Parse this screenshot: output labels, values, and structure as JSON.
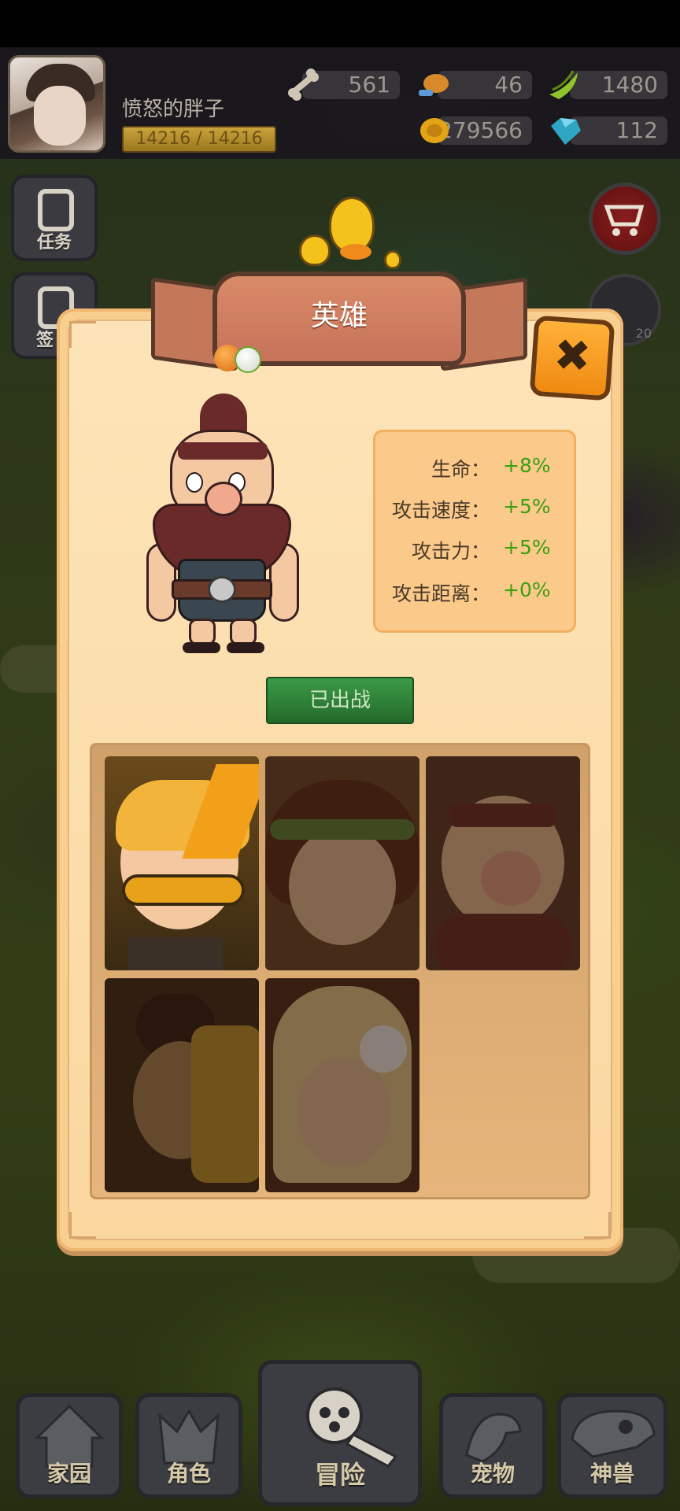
{
  "player": {
    "name": "愤怒的胖子",
    "hp": "14216 / 14216"
  },
  "resources": [
    {
      "icon": "bone-icon",
      "value": "561"
    },
    {
      "icon": "meat-icon",
      "value": "46"
    },
    {
      "icon": "banana-icon",
      "value": "1480"
    },
    {
      "icon": "gold-coin-icon",
      "value": "279566"
    },
    {
      "icon": "diamond-icon",
      "value": "112"
    }
  ],
  "side_buttons": {
    "tasks": "任务",
    "signin": "签",
    "badge_count": "20"
  },
  "dialog": {
    "title": "英雄",
    "close_symbol": "✖",
    "stats": [
      {
        "label": "生命：",
        "value": "+8%"
      },
      {
        "label": "攻击速度：",
        "value": "+5%"
      },
      {
        "label": "攻击力：",
        "value": "+5%"
      },
      {
        "label": "攻击距离：",
        "value": "+0%"
      }
    ],
    "deploy_label": "已出战",
    "roster": [
      {
        "name": "masked-hero",
        "locked": false
      },
      {
        "name": "girl-hero",
        "locked": true
      },
      {
        "name": "bearded-hero",
        "locked": true
      },
      {
        "name": "mohawk-hero",
        "locked": true
      },
      {
        "name": "blonde-hero",
        "locked": true
      }
    ]
  },
  "nav": [
    {
      "label": "家园",
      "icon": "home-icon"
    },
    {
      "label": "角色",
      "icon": "helmet-icon"
    },
    {
      "label": "冒险",
      "icon": "mace-icon"
    },
    {
      "label": "宠物",
      "icon": "dino-icon"
    },
    {
      "label": "神兽",
      "icon": "skull-icon"
    }
  ],
  "colors": {
    "stat_value": "#39a10f",
    "deploy_button": "#2f8a3a",
    "dialog_bg": "#fde4b8",
    "banner": "#c6735a"
  }
}
